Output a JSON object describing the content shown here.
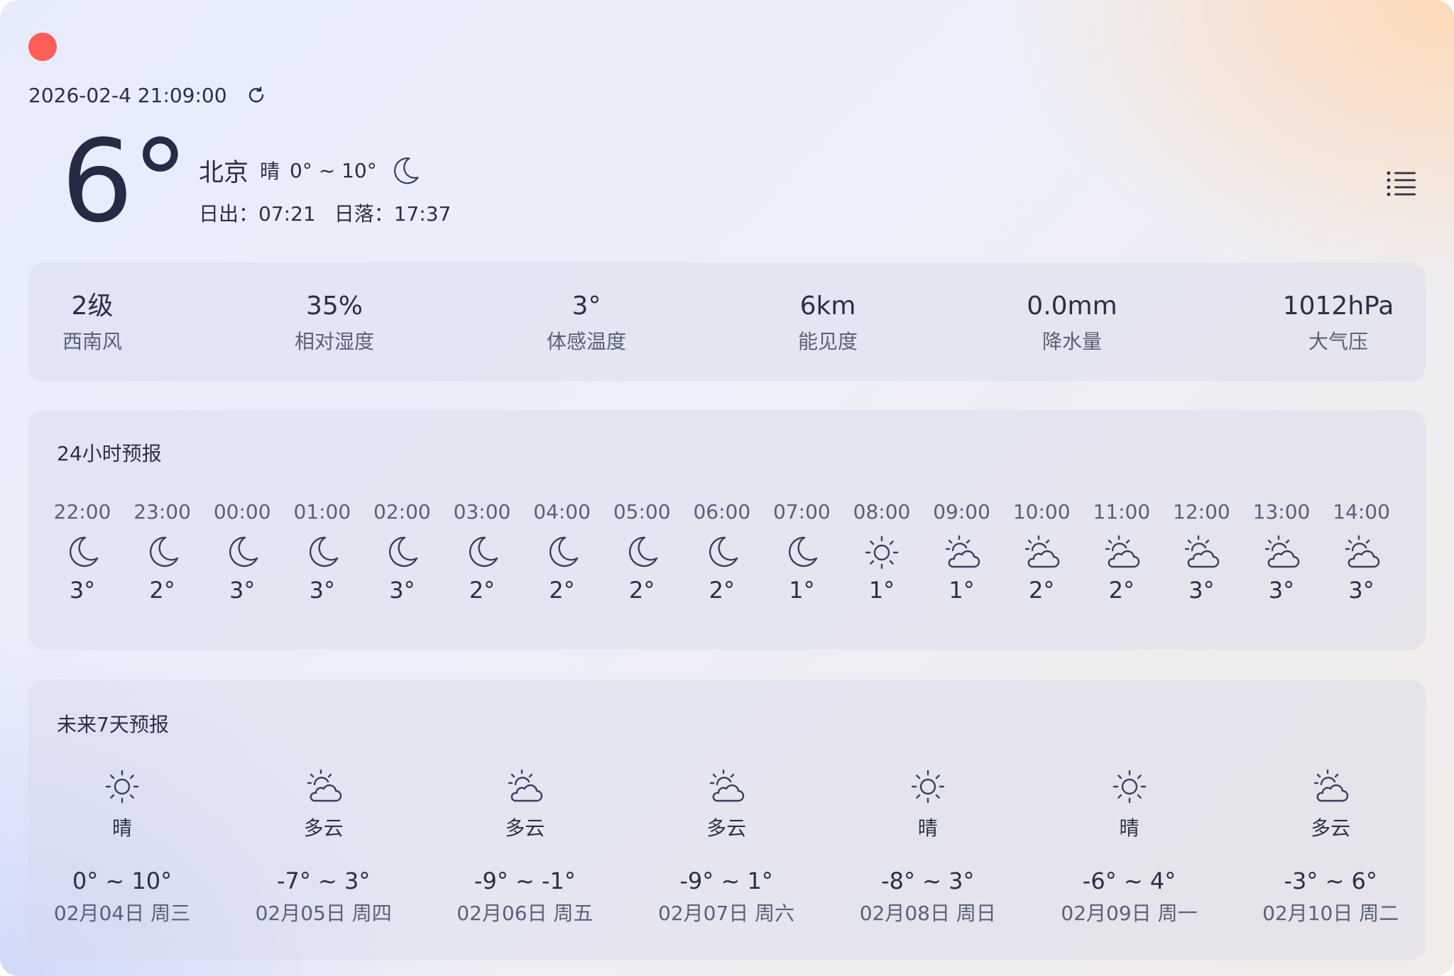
{
  "window": {
    "close_color": "#ff5f57"
  },
  "header": {
    "datetime": "2026-02-4 21:09:00",
    "temperature": "6°",
    "city": "北京",
    "weather": "晴",
    "temp_range": "0° ~ 10°",
    "weather_icon": "moon-icon",
    "sunrise": "日出：07:21",
    "sunset": "日落：17:37"
  },
  "stats": [
    {
      "value": "2级",
      "label": "西南风"
    },
    {
      "value": "35%",
      "label": "相对湿度"
    },
    {
      "value": "3°",
      "label": "体感温度"
    },
    {
      "value": "6km",
      "label": "能见度"
    },
    {
      "value": "0.0mm",
      "label": "降水量"
    },
    {
      "value": "1012hPa",
      "label": "大气压"
    }
  ],
  "hourly": {
    "title": "24小时预报",
    "items": [
      {
        "time": "22:00",
        "icon": "moon",
        "temp": "3°"
      },
      {
        "time": "23:00",
        "icon": "moon",
        "temp": "2°"
      },
      {
        "time": "00:00",
        "icon": "moon",
        "temp": "3°"
      },
      {
        "time": "01:00",
        "icon": "moon",
        "temp": "3°"
      },
      {
        "time": "02:00",
        "icon": "moon",
        "temp": "3°"
      },
      {
        "time": "03:00",
        "icon": "moon",
        "temp": "2°"
      },
      {
        "time": "04:00",
        "icon": "moon",
        "temp": "2°"
      },
      {
        "time": "05:00",
        "icon": "moon",
        "temp": "2°"
      },
      {
        "time": "06:00",
        "icon": "moon",
        "temp": "2°"
      },
      {
        "time": "07:00",
        "icon": "moon",
        "temp": "1°"
      },
      {
        "time": "08:00",
        "icon": "sun",
        "temp": "1°"
      },
      {
        "time": "09:00",
        "icon": "cloud-sun",
        "temp": "1°"
      },
      {
        "time": "10:00",
        "icon": "cloud-sun",
        "temp": "2°"
      },
      {
        "time": "11:00",
        "icon": "cloud-sun",
        "temp": "2°"
      },
      {
        "time": "12:00",
        "icon": "cloud-sun",
        "temp": "3°"
      },
      {
        "time": "13:00",
        "icon": "cloud-sun",
        "temp": "3°"
      },
      {
        "time": "14:00",
        "icon": "cloud-sun",
        "temp": "3°"
      }
    ]
  },
  "daily": {
    "title": "未来7天预报",
    "items": [
      {
        "icon": "sun",
        "condition": "晴",
        "range": "0° ~ 10°",
        "date": "02月04日 周三"
      },
      {
        "icon": "cloud-sun",
        "condition": "多云",
        "range": "-7° ~ 3°",
        "date": "02月05日 周四"
      },
      {
        "icon": "cloud-sun",
        "condition": "多云",
        "range": "-9° ~ -1°",
        "date": "02月06日 周五"
      },
      {
        "icon": "cloud-sun",
        "condition": "多云",
        "range": "-9° ~ 1°",
        "date": "02月07日 周六"
      },
      {
        "icon": "sun",
        "condition": "晴",
        "range": "-8° ~ 3°",
        "date": "02月08日 周日"
      },
      {
        "icon": "sun",
        "condition": "晴",
        "range": "-6° ~ 4°",
        "date": "02月09日 周一"
      },
      {
        "icon": "cloud-sun",
        "condition": "多云",
        "range": "-3° ~ 6°",
        "date": "02月10日 周二"
      }
    ]
  }
}
